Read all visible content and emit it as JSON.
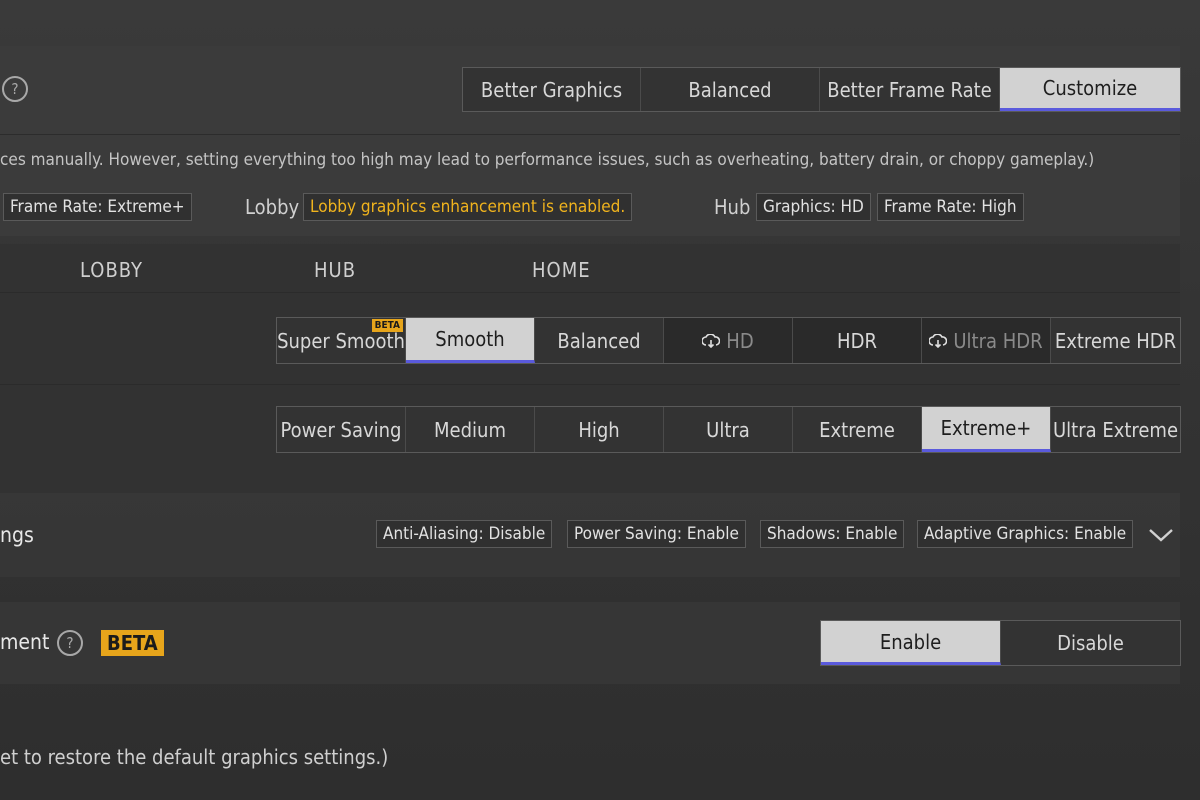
{
  "preset": {
    "options": [
      "Better Graphics",
      "Balanced",
      "Better Frame Rate",
      "Customize"
    ],
    "selected": "Customize",
    "warning": "ces manually. However, setting everything too high may lead to performance issues, such as overheating, battery drain, or choppy gameplay.)",
    "frame_rate_tag": "Frame Rate: Extreme+",
    "lobby_label": "Lobby",
    "lobby_status": "Lobby graphics enhancement is enabled.",
    "hub_label": "Hub",
    "hub_graphics": "Graphics: HD",
    "hub_frame_rate": "Frame Rate: High"
  },
  "tabs": [
    "LOBBY",
    "HUB",
    "HOME"
  ],
  "graphics": {
    "options": [
      "Super Smooth",
      "Smooth",
      "Balanced",
      "HD",
      "HDR",
      "Ultra HDR",
      "Extreme HDR"
    ],
    "selected": "Smooth",
    "beta_badge": "BETA"
  },
  "frame_rate": {
    "options": [
      "Power Saving",
      "Medium",
      "High",
      "Ultra",
      "Extreme",
      "Extreme+",
      "Ultra Extreme"
    ],
    "selected": "Extreme+"
  },
  "advanced": {
    "label": "ngs",
    "tags": [
      "Anti-Aliasing: Disable",
      "Power Saving: Enable",
      "Shadows: Enable",
      "Adaptive Graphics: Enable"
    ]
  },
  "lobby_enhancement": {
    "label": "ment",
    "beta_badge": "BETA",
    "options": [
      "Enable",
      "Disable"
    ],
    "selected": "Enable"
  },
  "reset_note": "et to restore the default graphics settings.)",
  "icons": {
    "help": "question-circle-icon",
    "cloud": "cloud-download-icon",
    "chevron": "chevron-down-icon"
  },
  "colors": {
    "accent": "#5a5adc",
    "gold": "#e7a51b",
    "selected_bg": "#d2d2d2"
  }
}
